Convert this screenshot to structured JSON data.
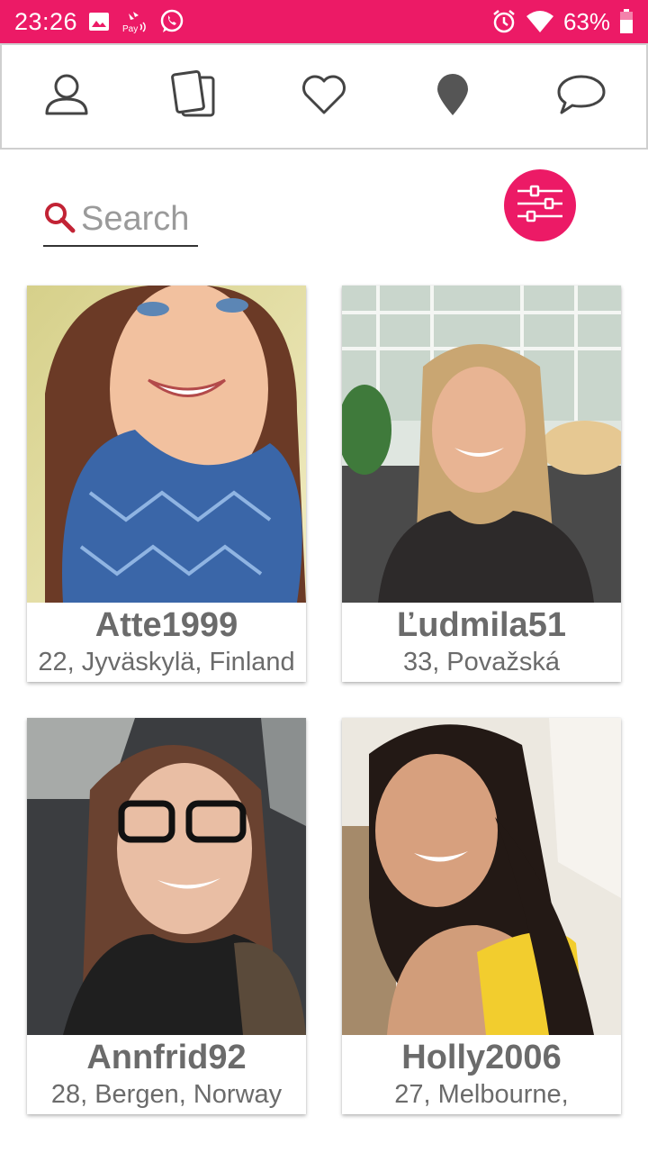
{
  "status_bar": {
    "time": "23:26",
    "battery": "63%",
    "icons": [
      "image-icon",
      "pay-icon",
      "whatsapp-icon",
      "alarm-icon",
      "wifi-icon",
      "battery-icon"
    ],
    "pay_text": "Pay"
  },
  "nav": {
    "items": [
      "profile-icon",
      "cards-icon",
      "heart-icon",
      "location-icon",
      "chat-icon"
    ]
  },
  "search": {
    "placeholder": "Search"
  },
  "colors": {
    "accent": "#ec1a66",
    "text": "#6b6b6b"
  },
  "profiles": [
    {
      "name": "Atte1999",
      "info": "22, Jyväskylä, Finland"
    },
    {
      "name": "Ľudmila51",
      "info": "33, Považská"
    },
    {
      "name": "Annfrid92",
      "info": "28, Bergen, Norway"
    },
    {
      "name": "Holly2006",
      "info": "27, Melbourne,"
    }
  ]
}
